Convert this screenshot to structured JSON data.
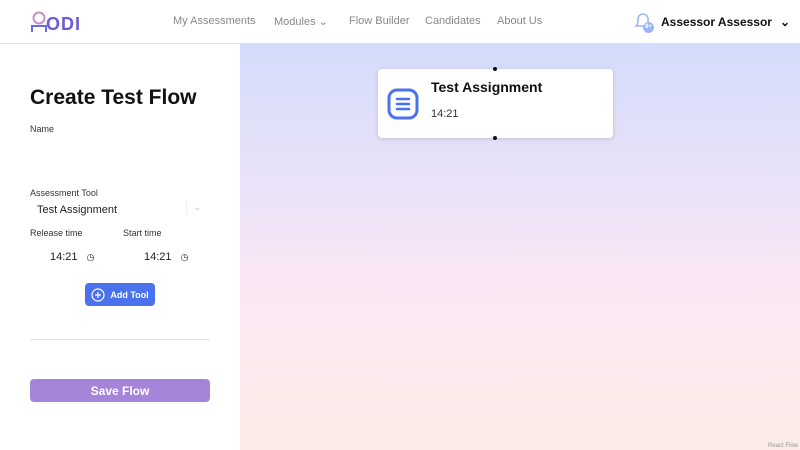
{
  "nav": {
    "logo": "ODI",
    "links": [
      "My Assessments",
      "Modules",
      "Flow Builder",
      "Candidates",
      "About Us"
    ],
    "user": "Assessor Assessor",
    "bell_badge": "8+"
  },
  "form": {
    "title": "Create Test Flow",
    "name_label": "Name",
    "name_value": "",
    "tool_label": "Assessment Tool",
    "tool_value": "Test Assignment",
    "release_label": "Release time",
    "release_value": "14:21",
    "start_label": "Start time",
    "start_value": "14:21",
    "add_tool": "Add Tool",
    "save": "Save Flow"
  },
  "canvas": {
    "node_title": "Test Assignment",
    "node_time": "14:21",
    "attribution": "React Flow"
  }
}
